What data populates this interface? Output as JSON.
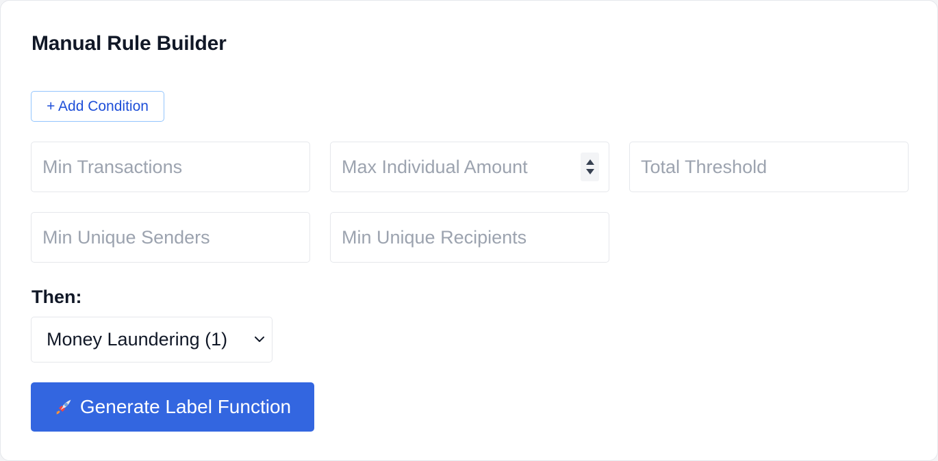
{
  "panel": {
    "title": "Manual Rule Builder"
  },
  "add_condition": {
    "label": "+ Add Condition"
  },
  "fields": {
    "min_transactions": {
      "placeholder": "Min Transactions",
      "value": ""
    },
    "max_individual_amount": {
      "placeholder": "Max Individual Amount",
      "value": ""
    },
    "total_threshold": {
      "placeholder": "Total Threshold",
      "value": ""
    },
    "min_unique_senders": {
      "placeholder": "Min Unique Senders",
      "value": ""
    },
    "min_unique_recipients": {
      "placeholder": "Min Unique Recipients",
      "value": ""
    }
  },
  "then": {
    "label": "Then:",
    "selected": "Money Laundering (1)"
  },
  "generate": {
    "icon": "rocket-icon",
    "label": "Generate Label Function"
  },
  "colors": {
    "accent": "#3366e0",
    "link": "#1d4ed8",
    "outline_button_border": "#93c5fd",
    "placeholder": "#9ca3af",
    "border": "#e5e7eb"
  }
}
